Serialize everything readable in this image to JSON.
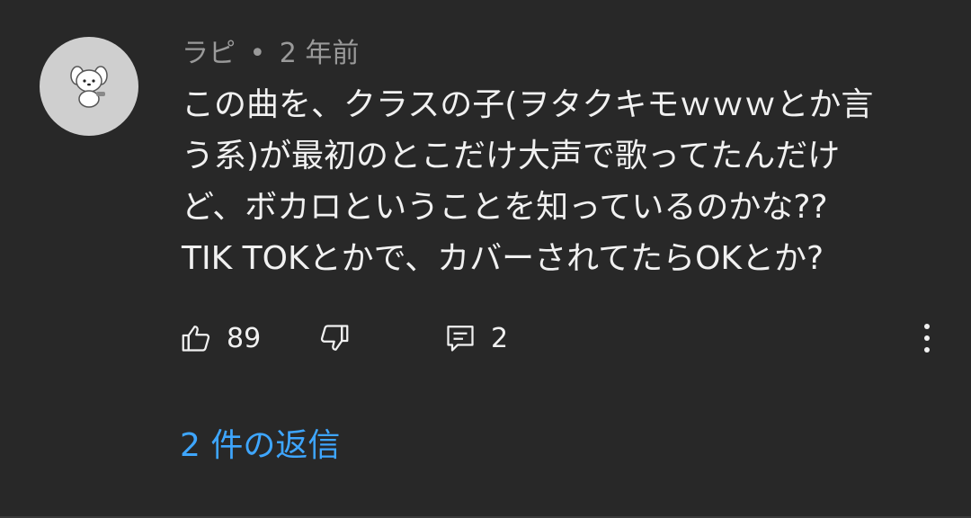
{
  "comment": {
    "author": "ラピ",
    "separator": "•",
    "time_ago": "2 年前",
    "text_lines": [
      "この曲を、クラスの子(ヲタクキモｗｗｗとか言",
      "う系)が最初のとこだけ大声で歌ってたんだけ",
      "ど、ボカロということを知っているのかな??",
      "TIK TOKとかで、カバーされてたらOKとか?"
    ],
    "avatar_icon": "pochacco-avatar-icon"
  },
  "actions": {
    "like_icon": "thumbs-up-icon",
    "like_count": "89",
    "dislike_icon": "thumbs-down-icon",
    "reply_icon": "comment-icon",
    "reply_count": "2",
    "more_icon": "more-vert-icon"
  },
  "replies": {
    "label": "2 件の返信",
    "color": "#3ea6ff"
  },
  "colors": {
    "background": "#282828",
    "text": "#f1f1f1",
    "meta": "#9a9a9a"
  }
}
